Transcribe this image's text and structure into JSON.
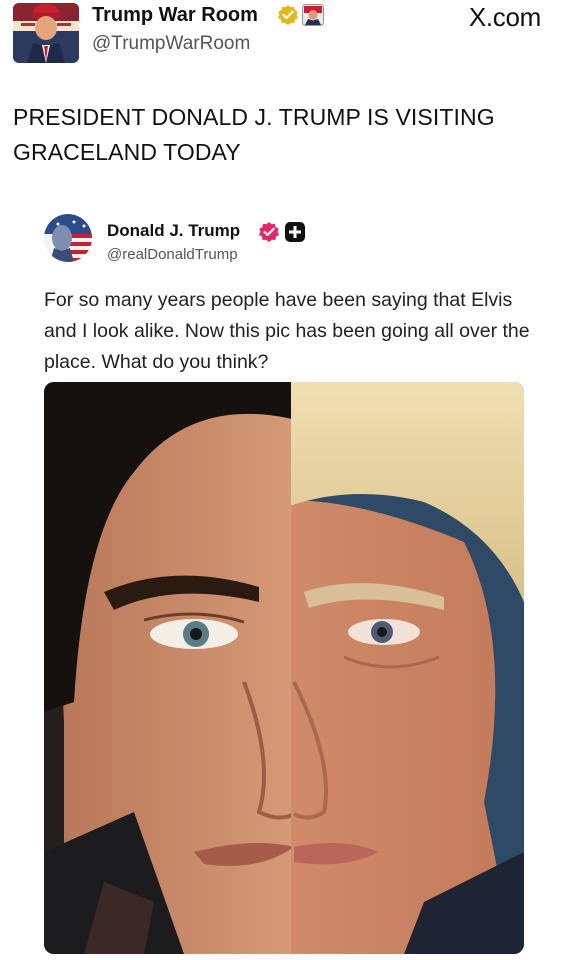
{
  "outer_post": {
    "display_name": "Trump War Room",
    "handle": "@TrumpWarRoom",
    "site_label": "X.com",
    "text": "PRESIDENT DONALD J. TRUMP IS VISITING GRACELAND TODAY"
  },
  "quoted_post": {
    "display_name": "Donald J. Trump",
    "handle": "@realDonaldTrump",
    "text": "For so many years people have been saying that Elvis and I look alike. Now this pic has been going all over the place. What do you think?"
  },
  "icons": [
    "verified-gold-icon",
    "affiliate-badge-icon",
    "verified-pink-icon",
    "plus-badge-icon"
  ],
  "colors": {
    "gold_badge": "#e2b719",
    "pink_badge": "#e8256a",
    "text": "#111111",
    "muted": "#555555"
  }
}
